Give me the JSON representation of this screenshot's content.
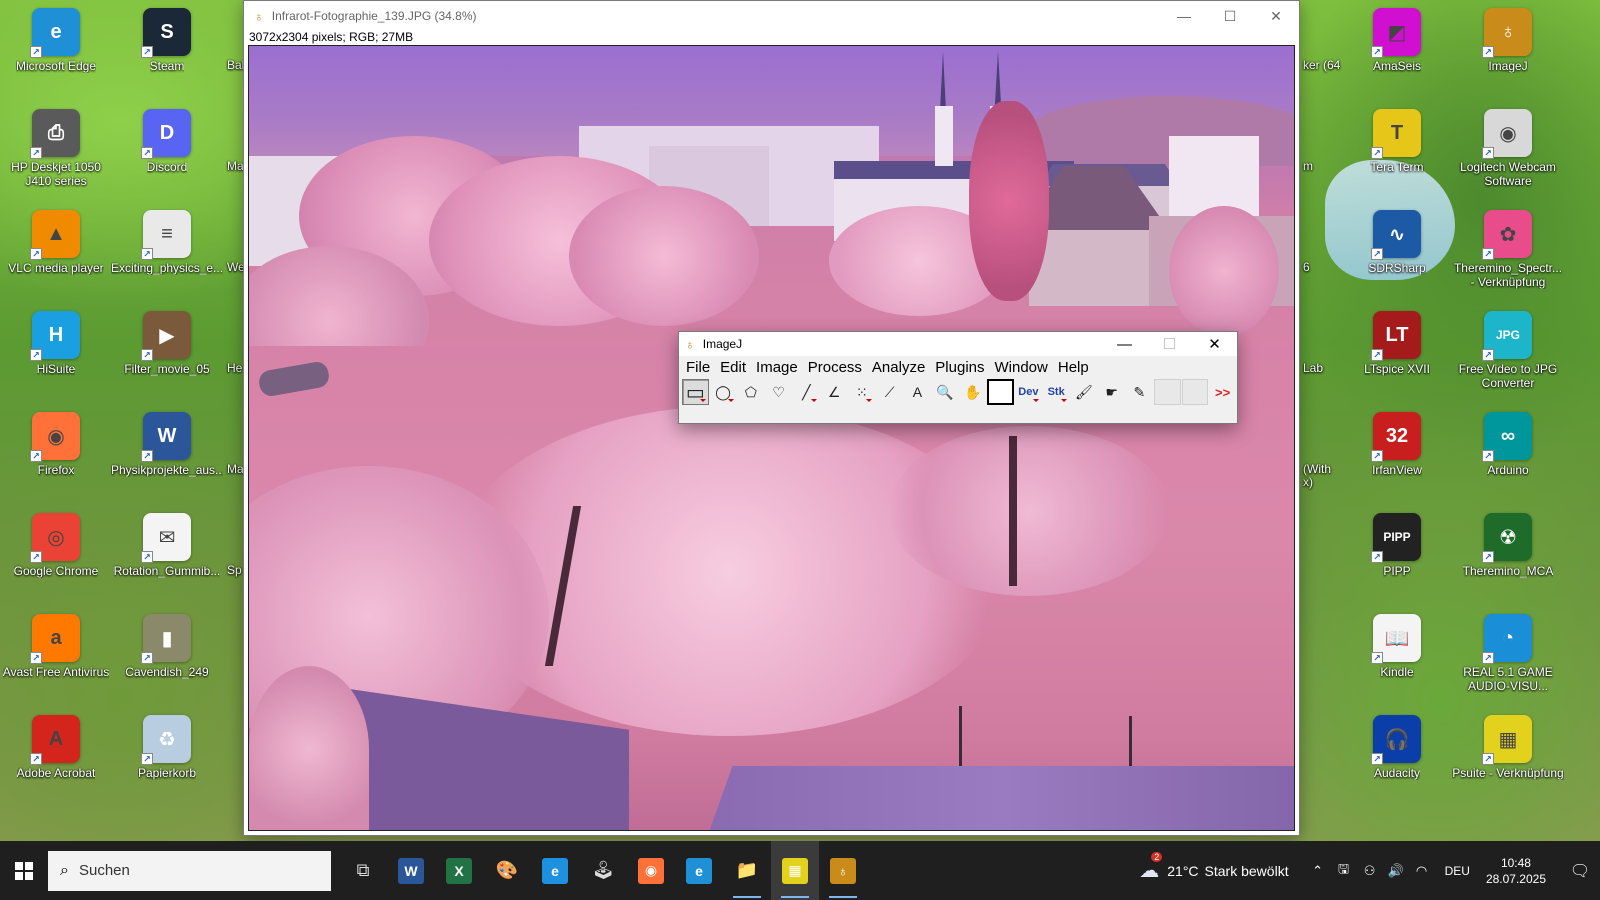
{
  "desktop": {
    "left_icons": [
      {
        "label": "Microsoft Edge",
        "color": "#1f8fd6",
        "glyph": "e"
      },
      {
        "label": "Steam",
        "color": "#1b2838",
        "glyph": "S"
      },
      {
        "label": "HP Deskjet 1050 J410 series",
        "color": "#5a5a5a",
        "glyph": "⎙"
      },
      {
        "label": "Discord",
        "color": "#5865f2",
        "glyph": "D"
      },
      {
        "label": "VLC media player",
        "color": "#f08a00",
        "glyph": "▲"
      },
      {
        "label": "Exciting_physics_e...",
        "color": "#e9e9e9",
        "glyph": "≡"
      },
      {
        "label": "HiSuite",
        "color": "#1aa0e0",
        "glyph": "H"
      },
      {
        "label": "Filter_movie_05",
        "color": "#7a5a3a",
        "glyph": "▶"
      },
      {
        "label": "Firefox",
        "color": "#ff7139",
        "glyph": "◉"
      },
      {
        "label": "Physikprojekte_aus...",
        "color": "#2b579a",
        "glyph": "W"
      },
      {
        "label": "Google Chrome",
        "color": "#ea4335",
        "glyph": "◎"
      },
      {
        "label": "Rotation_Gummib...",
        "color": "#f4f4f4",
        "glyph": "✉"
      },
      {
        "label": "Avast Free Antivirus",
        "color": "#ff7800",
        "glyph": "a"
      },
      {
        "label": "Cavendish_249",
        "color": "#8a8a6a",
        "glyph": "▮"
      },
      {
        "label": "Adobe Acrobat",
        "color": "#d4251c",
        "glyph": "A"
      },
      {
        "label": "Papierkorb",
        "color": "#b8cde0",
        "glyph": "♻"
      }
    ],
    "partial_labels": [
      "Bab",
      "Ma",
      "We",
      "He",
      "Ma",
      "Sp"
    ],
    "right_icons": [
      {
        "label": "AmaSeis",
        "color": "#d10fd1",
        "glyph": "◩"
      },
      {
        "label": "ImageJ",
        "color": "#c98b1a",
        "glyph": "♁"
      },
      {
        "label": "Tera Term",
        "color": "#e6c619",
        "glyph": "T"
      },
      {
        "label": "Logitech Webcam Software",
        "color": "#d8d8d8",
        "glyph": "◉"
      },
      {
        "label": "SDRSharp",
        "color": "#1c5aa6",
        "glyph": "∿"
      },
      {
        "label": "Theremino_Spectr... - Verknüpfung",
        "color": "#e84c8a",
        "glyph": "✿"
      },
      {
        "label": "LTspice XVII",
        "color": "#a51a1a",
        "glyph": "LT"
      },
      {
        "label": "Free Video to JPG Converter",
        "color": "#1cb5c9",
        "glyph": "JPG"
      },
      {
        "label": "IrfanView",
        "color": "#c81e1e",
        "glyph": "32"
      },
      {
        "label": "Arduino",
        "color": "#00979c",
        "glyph": "∞"
      },
      {
        "label": "PIPP",
        "color": "#222222",
        "glyph": "PIPP"
      },
      {
        "label": "Theremino_MCA",
        "color": "#1f6b2a",
        "glyph": "☢"
      },
      {
        "label": "Kindle",
        "color": "#f4f4f4",
        "glyph": "📖"
      },
      {
        "label": "REAL 5.1 GAME AUDIO-VISU...",
        "color": "#1b8ed8",
        "glyph": "◔"
      },
      {
        "label": "Audacity",
        "color": "#0b3ea8",
        "glyph": "🎧"
      },
      {
        "label": "Psuite - Verknüpfung",
        "color": "#e2d11d",
        "glyph": "▦"
      }
    ],
    "partial_right_labels": [
      "ker (64",
      "m",
      "6",
      "Lab",
      "(With",
      "x)"
    ]
  },
  "image_window": {
    "title": "Infrarot-Fotographie_139.JPG (34.8%)",
    "info": "3072x2304 pixels; RGB; 27MB"
  },
  "imagej": {
    "title": "ImageJ",
    "menus": [
      "File",
      "Edit",
      "Image",
      "Process",
      "Analyze",
      "Plugins",
      "Window",
      "Help"
    ],
    "tools": [
      {
        "name": "rectangle-tool-icon",
        "glyph": "▭",
        "active": true,
        "sub": true
      },
      {
        "name": "oval-tool-icon",
        "glyph": "◯",
        "sub": true
      },
      {
        "name": "polygon-tool-icon",
        "glyph": "⬠"
      },
      {
        "name": "freehand-tool-icon",
        "glyph": "♡"
      },
      {
        "name": "line-tool-icon",
        "glyph": "╱",
        "sub": true
      },
      {
        "name": "angle-tool-icon",
        "glyph": "∠"
      },
      {
        "name": "point-tool-icon",
        "glyph": "⁙",
        "sub": true
      },
      {
        "name": "wand-tool-icon",
        "glyph": "⟋"
      },
      {
        "name": "text-tool-icon",
        "glyph": "A"
      },
      {
        "name": "magnifier-tool-icon",
        "glyph": "🔍"
      },
      {
        "name": "hand-tool-icon",
        "glyph": "✋"
      },
      {
        "name": "color-picker-tool-icon",
        "glyph": "■"
      },
      {
        "name": "dev-menu-tool",
        "glyph": "Dev",
        "txt": true,
        "sub": true
      },
      {
        "name": "stk-menu-tool",
        "glyph": "Stk",
        "txt": true,
        "sub": true
      },
      {
        "name": "brush-tool-icon",
        "glyph": "🖌"
      },
      {
        "name": "flood-fill-tool-icon",
        "glyph": "☛"
      },
      {
        "name": "pencil-tool-icon",
        "glyph": "✎"
      },
      {
        "name": "blank-tool-1",
        "glyph": "",
        "blank": true
      },
      {
        "name": "blank-tool-2",
        "glyph": "",
        "blank": true
      },
      {
        "name": "more-tools-button",
        "glyph": ">>",
        "more": true
      }
    ]
  },
  "taskbar": {
    "search_placeholder": "Suchen",
    "apps": [
      {
        "name": "task-view-icon",
        "glyph": "⧉",
        "color": "",
        "running": false
      },
      {
        "name": "word-icon",
        "glyph": "W",
        "color": "#2b579a",
        "running": false
      },
      {
        "name": "excel-icon",
        "glyph": "X",
        "color": "#217346",
        "running": false
      },
      {
        "name": "paint-icon",
        "glyph": "🎨",
        "color": "",
        "running": false
      },
      {
        "name": "internet-explorer-icon",
        "glyph": "e",
        "color": "#1e90e0",
        "running": false
      },
      {
        "name": "game-app-icon",
        "glyph": "🕹",
        "color": "",
        "running": false
      },
      {
        "name": "firefox-icon",
        "glyph": "◉",
        "color": "#ff7139",
        "running": false
      },
      {
        "name": "edge-icon",
        "glyph": "e",
        "color": "#1f8fd6",
        "running": false
      },
      {
        "name": "file-explorer-icon",
        "glyph": "📁",
        "color": "",
        "running": true
      },
      {
        "name": "psuite-taskbar-icon",
        "glyph": "▦",
        "color": "#e2d11d",
        "running": true,
        "active": true
      },
      {
        "name": "imagej-taskbar-icon",
        "glyph": "♁",
        "color": "#c98b1a",
        "running": true
      }
    ],
    "weather_temp": "21°C",
    "weather_text": "Stark bewölkt",
    "weather_badge": "2",
    "language": "DEU",
    "time": "10:48",
    "date": "28.07.2025"
  }
}
